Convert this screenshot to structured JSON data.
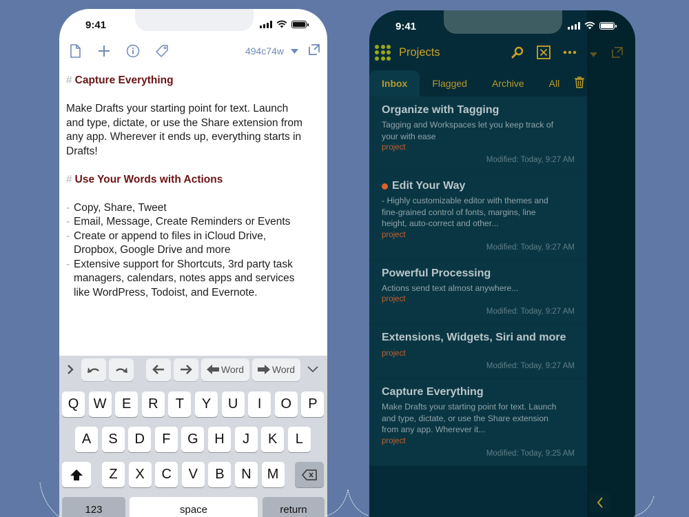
{
  "colors": {
    "background": "#5f78a5",
    "light_accent": "#6f89b8",
    "heading_red": "#6b1414",
    "dark_bg": "#062b38",
    "dark_accent": "#c9a227",
    "tag_orange": "#c0602e",
    "flag_dot": "#d9622b"
  },
  "left_phone": {
    "status_time": "9:41",
    "toolbar": {
      "icons": [
        "new-draft-icon",
        "plus-icon",
        "info-icon",
        "tag-icon"
      ],
      "draft_id": "494c74w",
      "dropdown_icon": "caret-down-icon",
      "expand_icon": "expand-icon"
    },
    "editor": {
      "hash": "#",
      "heading1": "Capture Everything",
      "para1_lines": [
        "Make Drafts your starting point for text. Launch",
        "and type, dictate, or use the Share extension from",
        "any app. Wherever it ends up, everything starts in",
        "Drafts!"
      ],
      "heading2": "Use Your Words with Actions",
      "list_dash": "-",
      "list": [
        [
          "Copy, Share, Tweet"
        ],
        [
          "Email, Message, Create Reminders or Events"
        ],
        [
          "Create or append to files in iCloud Drive,",
          "Dropbox, Google Drive and more"
        ],
        [
          "Extensive support for Shortcuts, 3rd party task",
          "managers, calendars, notes apps and services",
          "like WordPress, Todoist, and Evernote."
        ]
      ]
    },
    "keyboard_accessory": {
      "word_left": "Word",
      "word_right": "Word"
    },
    "keyboard": {
      "row1": [
        "Q",
        "W",
        "E",
        "R",
        "T",
        "Y",
        "U",
        "I",
        "O",
        "P"
      ],
      "row2": [
        "A",
        "S",
        "D",
        "F",
        "G",
        "H",
        "J",
        "K",
        "L"
      ],
      "row3": [
        "Z",
        "X",
        "C",
        "V",
        "B",
        "N",
        "M"
      ],
      "numbers": "123",
      "space": "space",
      "return": "return"
    }
  },
  "right_phone": {
    "status_time": "9:41",
    "header": {
      "title": "Projects"
    },
    "tabs": [
      {
        "label": "Inbox",
        "active": true
      },
      {
        "label": "Flagged",
        "active": false
      },
      {
        "label": "Archive",
        "active": false
      },
      {
        "label": "All",
        "active": false
      }
    ],
    "drafts": [
      {
        "title": "Organize with Tagging",
        "flagged": false,
        "body": [
          "Tagging and Workspaces let you keep track of",
          "your with ease"
        ],
        "tag": "project",
        "modified": "Modified: Today, 9:27 AM"
      },
      {
        "title": "Edit Your Way",
        "flagged": true,
        "body": [
          "- Highly customizable editor with themes and",
          "fine-grained control of fonts, margins, line",
          "height, auto-correct and other..."
        ],
        "tag": "project",
        "modified": "Modified: Today, 9:27 AM"
      },
      {
        "title": "Powerful Processing",
        "flagged": false,
        "body": [
          "Actions send text almost anywhere..."
        ],
        "tag": "project",
        "modified": "Modified: Today, 9:27 AM"
      },
      {
        "title": "Extensions, Widgets, Siri and more",
        "flagged": false,
        "body": [],
        "tag": "project",
        "modified": "Modified: Today, 9:27 AM"
      },
      {
        "title": "Capture Everything",
        "flagged": false,
        "body": [
          "Make Drafts your starting point for text. Launch",
          "and type, dictate, or use the Share extension",
          "from any app. Wherever it..."
        ],
        "tag": "project",
        "modified": "Modified: Today, 9:25 AM"
      }
    ]
  }
}
